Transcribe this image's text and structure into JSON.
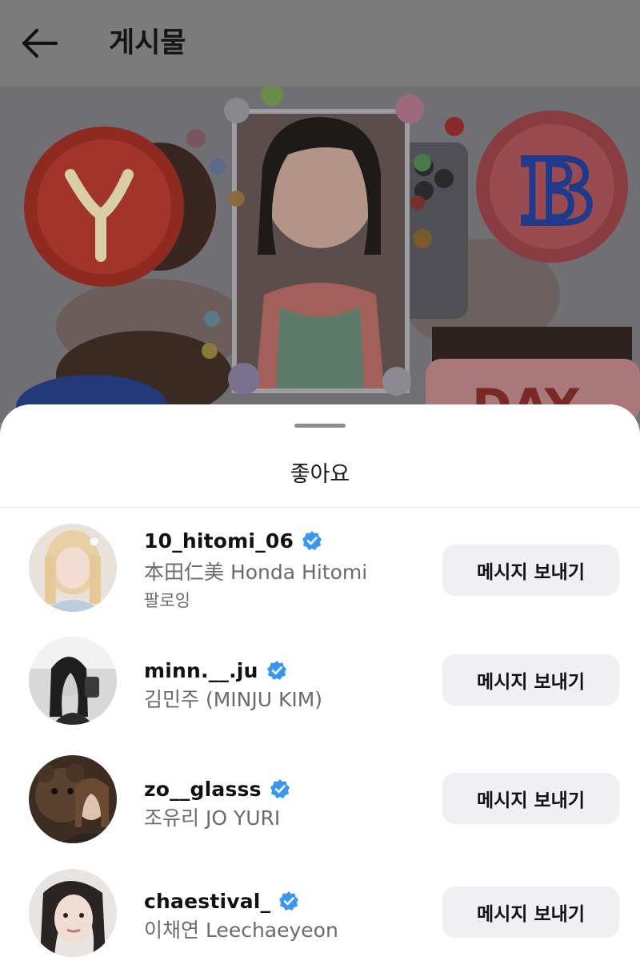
{
  "header": {
    "title": "게시물",
    "back_icon": "arrow-left-icon"
  },
  "post": {
    "cake_letters": [
      "Y",
      "B",
      "DAY"
    ]
  },
  "sheet": {
    "title": "좋아요"
  },
  "likes": [
    {
      "username": "10_hitomi_06",
      "fullname": "本田仁美 Honda Hitomi",
      "status": "팔로잉",
      "button": "메시지 보내기",
      "verified": true
    },
    {
      "username": "minn.__.ju",
      "fullname": "김민주 (MINJU KIM)",
      "status": "",
      "button": "메시지 보내기",
      "verified": true
    },
    {
      "username": "zo__glasss",
      "fullname": "조유리 JO YURI",
      "status": "",
      "button": "메시지 보내기",
      "verified": true
    },
    {
      "username": "chaestival_",
      "fullname": "이채연 Leechaeyeon",
      "status": "",
      "button": "메시지 보내기",
      "verified": true
    }
  ],
  "colors": {
    "verified_blue": "#3897f0",
    "button_bg": "#efeff4",
    "overlay": "#7b7b7b"
  }
}
